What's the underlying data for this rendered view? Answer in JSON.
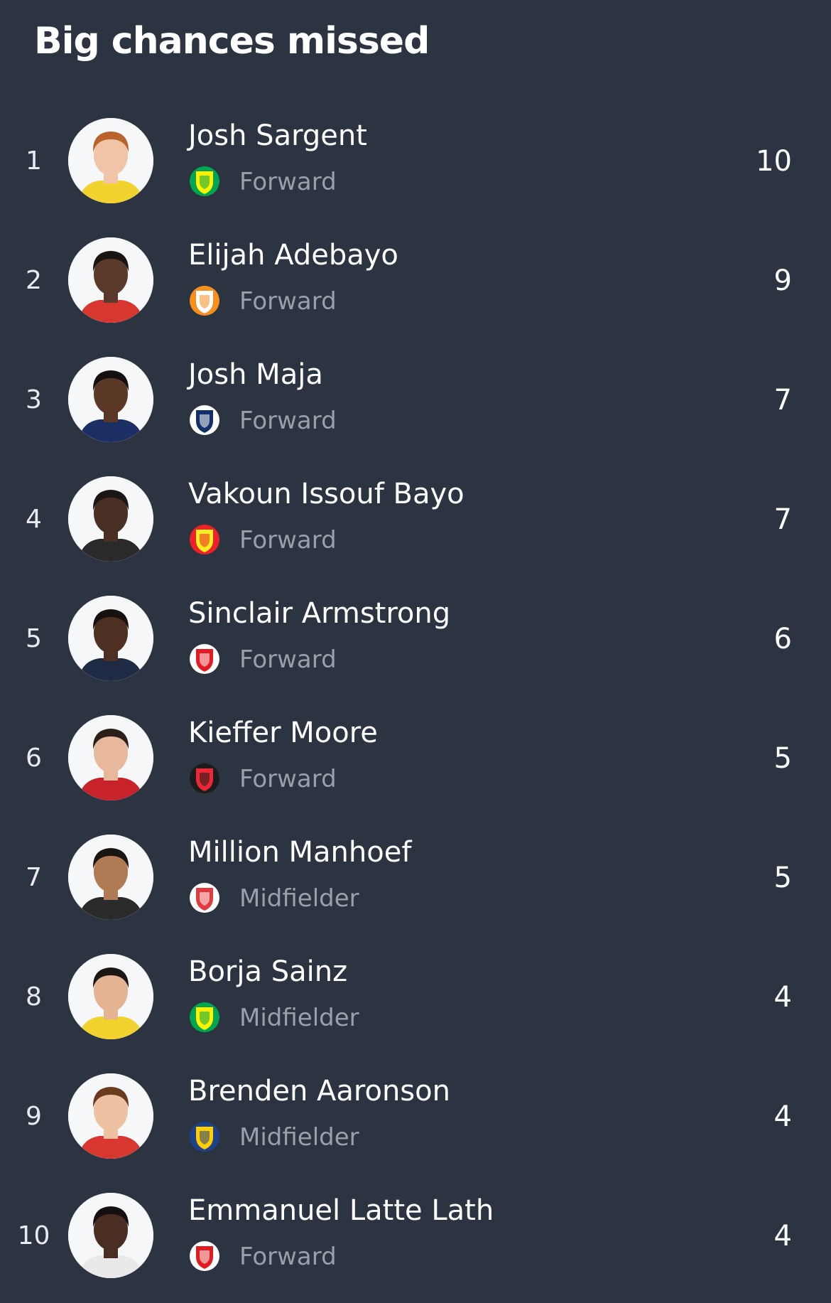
{
  "title": "Big chances missed",
  "players": [
    {
      "rank": "1",
      "name": "Josh Sargent",
      "position": "Forward",
      "value": "10",
      "club_icon": "norwich-crest-icon",
      "crest_colors": [
        "#fff200",
        "#00a650"
      ],
      "skin": "#f1c4a8",
      "hair": "#b8632c",
      "shirt": "#f2d22e"
    },
    {
      "rank": "2",
      "name": "Elijah Adebayo",
      "position": "Forward",
      "value": "9",
      "club_icon": "luton-crest-icon",
      "crest_colors": [
        "#ffffff",
        "#f78f1e"
      ],
      "skin": "#5a3a2a",
      "hair": "#1a1412",
      "shirt": "#d7372f"
    },
    {
      "rank": "3",
      "name": "Josh Maja",
      "position": "Forward",
      "value": "7",
      "club_icon": "west-brom-crest-icon",
      "crest_colors": [
        "#122f67",
        "#ffffff"
      ],
      "skin": "#5b3826",
      "hair": "#161110",
      "shirt": "#1b2f64"
    },
    {
      "rank": "4",
      "name": "Vakoun Issouf Bayo",
      "position": "Forward",
      "value": "7",
      "club_icon": "watford-crest-icon",
      "crest_colors": [
        "#fbee23",
        "#ed2127"
      ],
      "skin": "#4a3024",
      "hair": "#1c1614",
      "shirt": "#2a2a2a"
    },
    {
      "rank": "5",
      "name": "Sinclair Armstrong",
      "position": "Forward",
      "value": "6",
      "club_icon": "bristol-city-crest-icon",
      "crest_colors": [
        "#e21b23",
        "#ffffff"
      ],
      "skin": "#4e3022",
      "hair": "#17110f",
      "shirt": "#1f2a44"
    },
    {
      "rank": "6",
      "name": "Kieffer Moore",
      "position": "Forward",
      "value": "5",
      "club_icon": "sheffield-united-crest-icon",
      "crest_colors": [
        "#ee2737",
        "#1c1c1c"
      ],
      "skin": "#e8b89c",
      "hair": "#2b1f1a",
      "shirt": "#c8222b"
    },
    {
      "rank": "7",
      "name": "Million Manhoef",
      "position": "Midfielder",
      "value": "5",
      "club_icon": "stoke-crest-icon",
      "crest_colors": [
        "#e03a3e",
        "#ffffff"
      ],
      "skin": "#b07a55",
      "hair": "#1b1512",
      "shirt": "#2a2a2a"
    },
    {
      "rank": "8",
      "name": "Borja Sainz",
      "position": "Midfielder",
      "value": "4",
      "club_icon": "norwich-crest-icon",
      "crest_colors": [
        "#fff200",
        "#00a650"
      ],
      "skin": "#e3b392",
      "hair": "#1d1714",
      "shirt": "#f2d22e"
    },
    {
      "rank": "9",
      "name": "Brenden Aaronson",
      "position": "Midfielder",
      "value": "4",
      "club_icon": "leeds-crest-icon",
      "crest_colors": [
        "#ffcd00",
        "#1d428a"
      ],
      "skin": "#eec1a2",
      "hair": "#6b3b1f",
      "shirt": "#d7372f"
    },
    {
      "rank": "10",
      "name": "Emmanuel Latte Lath",
      "position": "Forward",
      "value": "4",
      "club_icon": "middlesbrough-crest-icon",
      "crest_colors": [
        "#e11b22",
        "#ffffff"
      ],
      "skin": "#4a2e22",
      "hair": "#161110",
      "shirt": "#e9e9e9"
    }
  ]
}
